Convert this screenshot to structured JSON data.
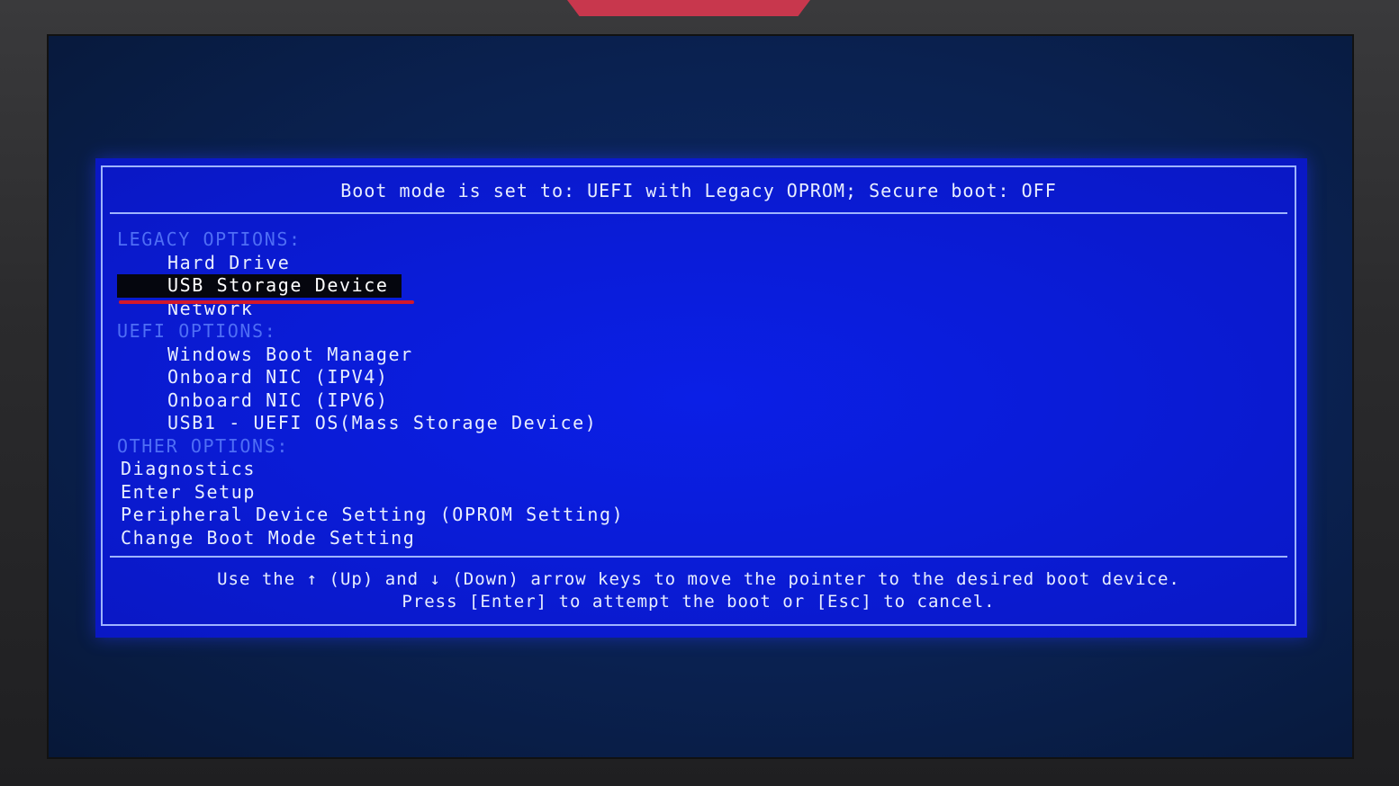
{
  "header": {
    "boot_mode_text": "Boot mode is set to: UEFI with Legacy OPROM; Secure boot: OFF"
  },
  "boot_menu": {
    "legacy": {
      "title": "LEGACY OPTIONS:",
      "items": [
        "Hard Drive",
        "USB Storage Device",
        "Network"
      ],
      "selected_index": 1
    },
    "uefi": {
      "title": "UEFI OPTIONS:",
      "items": [
        "Windows Boot Manager",
        "Onboard NIC (IPV4)",
        "Onboard NIC (IPV6)",
        "USB1 - UEFI OS(Mass Storage Device)"
      ]
    },
    "other": {
      "title": "OTHER OPTIONS:",
      "items": [
        "Diagnostics",
        "Enter Setup",
        "Peripheral Device Setting (OPROM Setting)",
        "Change Boot Mode Setting"
      ]
    }
  },
  "footer": {
    "line1": "Use the ↑ (Up) and ↓ (Down) arrow keys to move the pointer to the desired boot device.",
    "line2": "Press [Enter] to attempt the boot or [Esc] to cancel."
  },
  "colors": {
    "bios_background": "#0a1cd8",
    "text": "#e8eeff",
    "section_title": "#4f6ef5",
    "selected_background": "#05060e",
    "annotation_underline": "#d3182a"
  }
}
